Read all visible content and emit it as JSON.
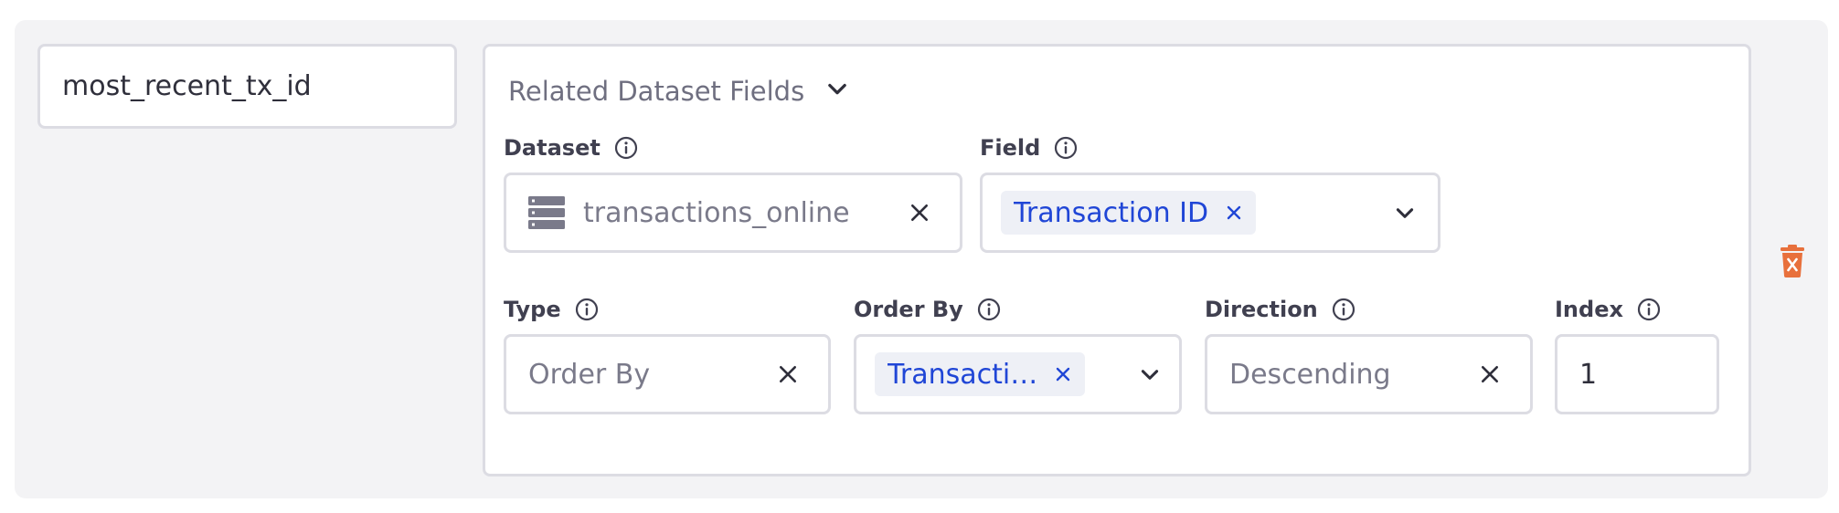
{
  "row": {
    "name_value": "most_recent_tx_id"
  },
  "section": {
    "title": "Related Dataset Fields"
  },
  "dataset": {
    "label": "Dataset",
    "value": "transactions_online"
  },
  "field": {
    "label": "Field",
    "tag": "Transaction ID"
  },
  "type": {
    "label": "Type",
    "value": "Order By"
  },
  "order_by": {
    "label": "Order By",
    "tag": "Transacti…"
  },
  "direction": {
    "label": "Direction",
    "value": "Descending"
  },
  "index": {
    "label": "Index",
    "value": "1"
  },
  "colors": {
    "tag_text": "#2046d6",
    "tag_bg": "#eef0f6",
    "delete_icon": "#e8703c",
    "panel_bg": "#f3f3f5",
    "border": "#dcdce3"
  },
  "icons": {
    "section_toggle": "chevron-down-icon",
    "info": "info-icon",
    "dataset": "dataset-table-icon",
    "clear": "close-icon",
    "dropdown": "chevron-down-icon",
    "delete": "trash-icon"
  }
}
